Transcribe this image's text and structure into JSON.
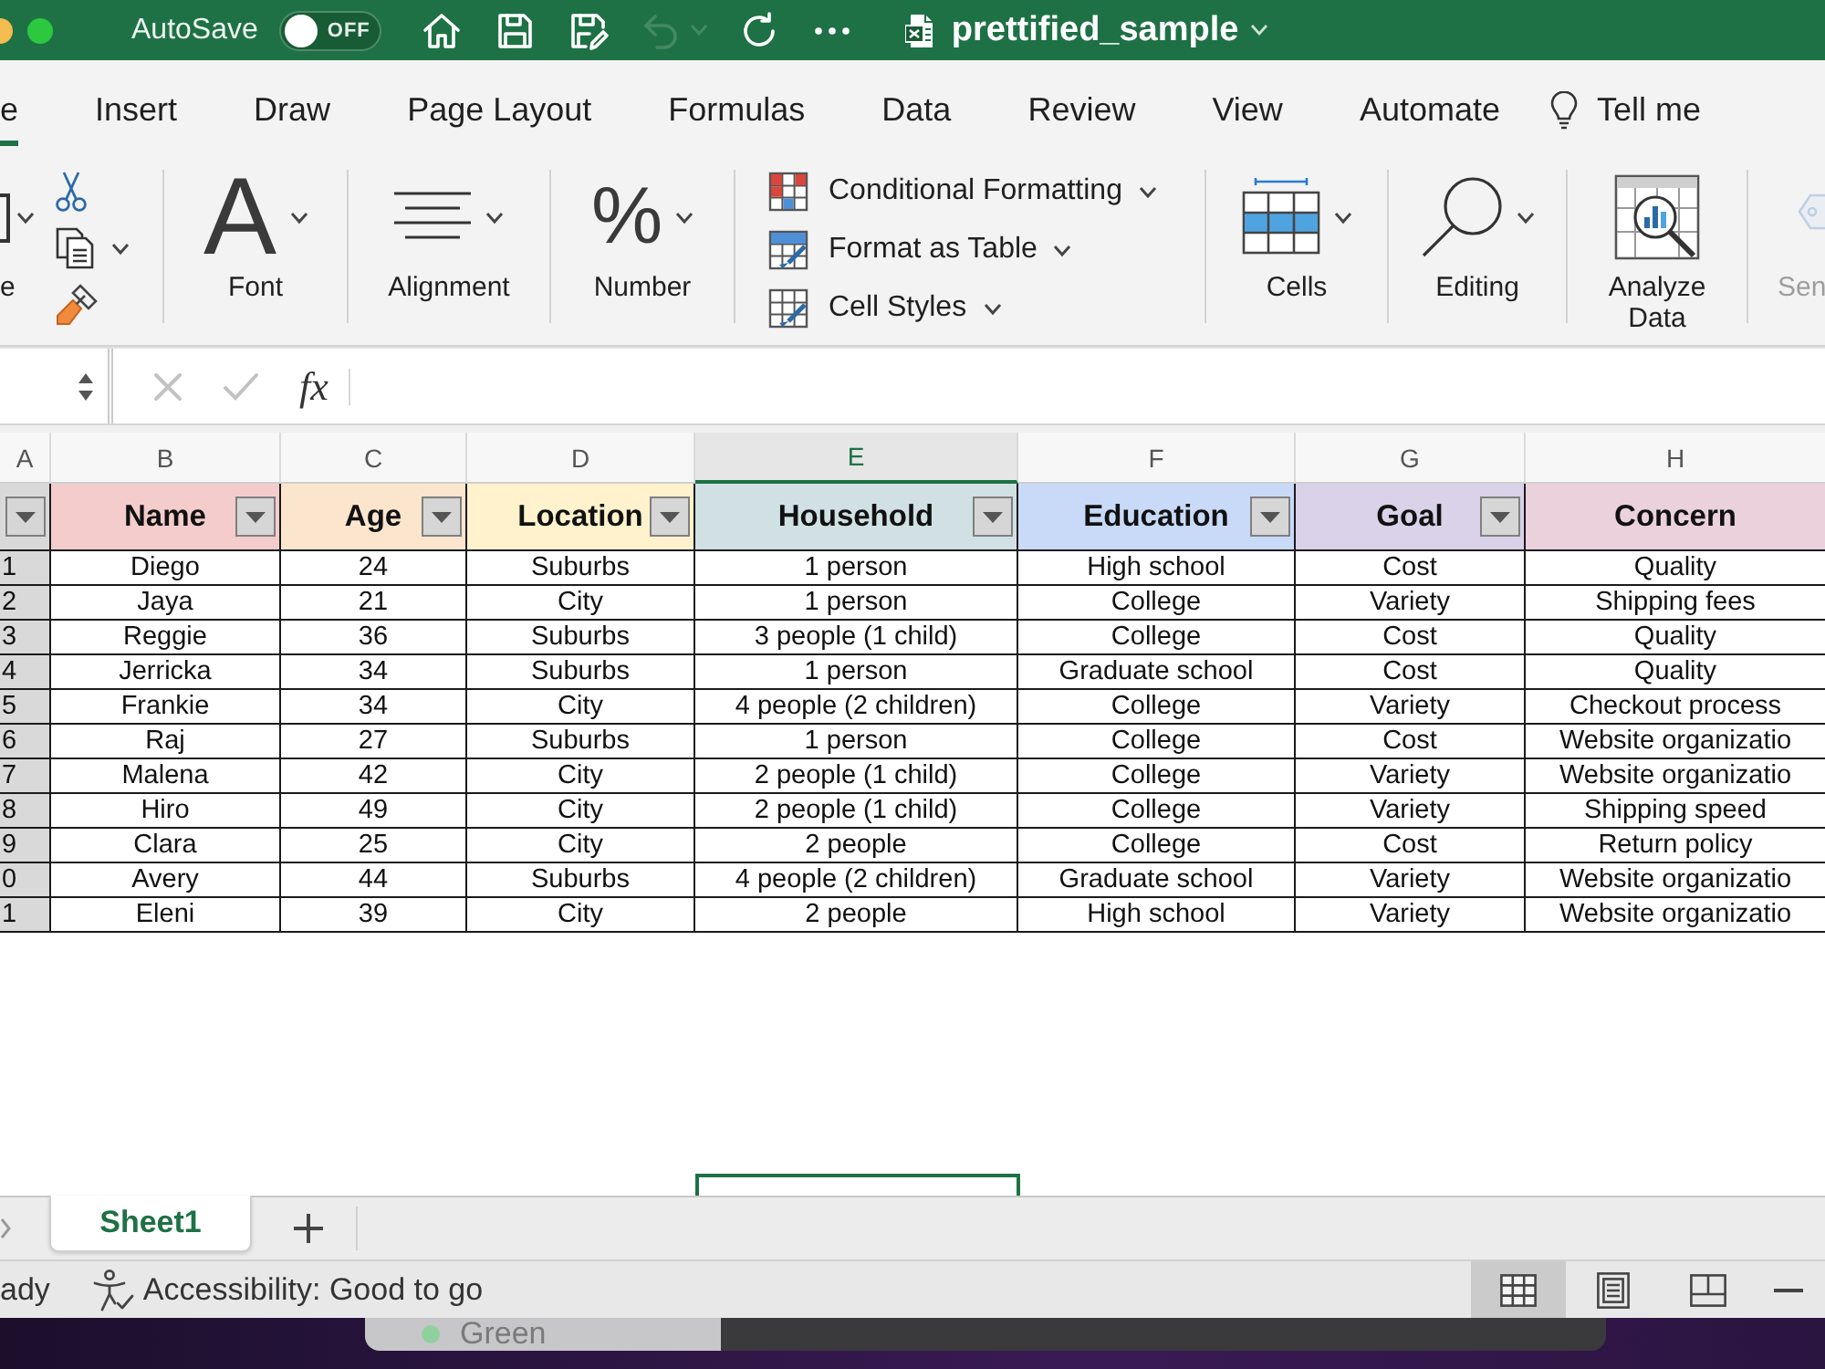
{
  "title_bar": {
    "autosave": {
      "label": "AutoSave",
      "on": false,
      "state_text": "OFF"
    },
    "quick_access": [
      {
        "kind": "home",
        "disabled": false
      },
      {
        "kind": "save",
        "disabled": false
      },
      {
        "kind": "save_as",
        "disabled": false
      },
      {
        "kind": "undo",
        "disabled": true
      },
      {
        "kind": "redo",
        "disabled": false
      },
      {
        "kind": "more",
        "disabled": false
      }
    ],
    "document_title": "prettified_sample"
  },
  "ribbon_tabs": [
    {
      "label": "e",
      "selected": true
    },
    {
      "label": "Insert",
      "selected": false
    },
    {
      "label": "Draw",
      "selected": false
    },
    {
      "label": "Page Layout",
      "selected": false
    },
    {
      "label": "Formulas",
      "selected": false
    },
    {
      "label": "Data",
      "selected": false
    },
    {
      "label": "Review",
      "selected": false
    },
    {
      "label": "View",
      "selected": false
    },
    {
      "label": "Automate",
      "selected": false
    }
  ],
  "tell_me": "Tell me",
  "ribbon": {
    "groups": [
      {
        "kind": "clipboard",
        "label": "e",
        "disabled": false
      },
      {
        "kind": "font",
        "glyph": "A",
        "label": "Font",
        "disabled": false
      },
      {
        "kind": "alignment",
        "label": "Alignment",
        "disabled": false
      },
      {
        "kind": "number",
        "glyph": "%",
        "label": "Number",
        "disabled": false
      },
      {
        "kind": "styles",
        "disabled": false,
        "items": [
          {
            "kind": "conditional",
            "label": "Conditional Formatting"
          },
          {
            "kind": "table",
            "label": "Format as Table"
          },
          {
            "kind": "cell_styles",
            "label": "Cell Styles"
          }
        ]
      },
      {
        "kind": "cells",
        "label": "Cells",
        "disabled": false
      },
      {
        "kind": "editing",
        "label": "Editing",
        "disabled": false
      },
      {
        "kind": "analyze",
        "label": "Analyze Data",
        "disabled": false
      },
      {
        "kind": "sensitivity",
        "label": "Sen",
        "disabled": true
      }
    ]
  },
  "formula_bar": {
    "buttons": [
      {
        "kind": "cancel",
        "disabled": true
      },
      {
        "kind": "enter",
        "disabled": true
      }
    ],
    "function_label": "fx"
  },
  "sheet": {
    "columns": [
      {
        "letter": "A",
        "selected": false
      },
      {
        "letter": "B",
        "selected": false
      },
      {
        "letter": "C",
        "selected": false
      },
      {
        "letter": "D",
        "selected": false
      },
      {
        "letter": "E",
        "selected": true
      },
      {
        "letter": "F",
        "selected": false
      },
      {
        "letter": "G",
        "selected": false
      },
      {
        "letter": "H",
        "selected": false
      }
    ],
    "header": [
      {
        "color": "#d9d9d9",
        "filter": true
      },
      {
        "label": "Name",
        "color": "#f4cccc",
        "filter": true
      },
      {
        "label": "Age",
        "color": "#fce5cd",
        "filter": true
      },
      {
        "label": "Location",
        "color": "#fff2cc",
        "filter": true
      },
      {
        "label": "Household",
        "color": "#d0e0e3",
        "filter": true
      },
      {
        "label": "Education",
        "color": "#c9daf8",
        "filter": true
      },
      {
        "label": "Goal",
        "color": "#d9d2e9",
        "filter": true
      },
      {
        "label": "Concern",
        "color": "#ead1dc",
        "filter": false
      }
    ],
    "rows": [
      [
        "1",
        "Diego",
        "24",
        "Suburbs",
        "1 person",
        "High school",
        "Cost",
        "Quality"
      ],
      [
        "2",
        "Jaya",
        "21",
        "City",
        "1 person",
        "College",
        "Variety",
        "Shipping fees"
      ],
      [
        "3",
        "Reggie",
        "36",
        "Suburbs",
        "3 people (1 child)",
        "College",
        "Cost",
        "Quality"
      ],
      [
        "4",
        "Jerricka",
        "34",
        "Suburbs",
        "1 person",
        "Graduate school",
        "Cost",
        "Quality"
      ],
      [
        "5",
        "Frankie",
        "34",
        "City",
        "4 people (2 children)",
        "College",
        "Variety",
        "Checkout process"
      ],
      [
        "6",
        "Raj",
        "27",
        "Suburbs",
        "1 person",
        "College",
        "Cost",
        "Website organizatio"
      ],
      [
        "7",
        "Malena",
        "42",
        "City",
        "2 people (1 child)",
        "College",
        "Variety",
        "Website organizatio"
      ],
      [
        "8",
        "Hiro",
        "49",
        "City",
        "2 people (1 child)",
        "College",
        "Variety",
        "Shipping speed"
      ],
      [
        "9",
        "Clara",
        "25",
        "City",
        "2 people",
        "College",
        "Cost",
        "Return policy"
      ],
      [
        "0",
        "Avery",
        "44",
        "Suburbs",
        "4 people (2 children)",
        "Graduate school",
        "Variety",
        "Website organizatio"
      ],
      [
        "1",
        "Eleni",
        "39",
        "City",
        "2 people",
        "High school",
        "Variety",
        "Website organizatio"
      ]
    ]
  },
  "sheet_tabs": [
    {
      "label": "Sheet1",
      "selected": true
    }
  ],
  "status_bar": {
    "left_text": "ady",
    "accessibility": "Accessibility: Good to go",
    "views": [
      {
        "kind": "normal",
        "selected": true
      },
      {
        "kind": "page_layout",
        "selected": false
      },
      {
        "kind": "page_break",
        "selected": false
      }
    ]
  },
  "desktop": {
    "window_label": "Green"
  }
}
